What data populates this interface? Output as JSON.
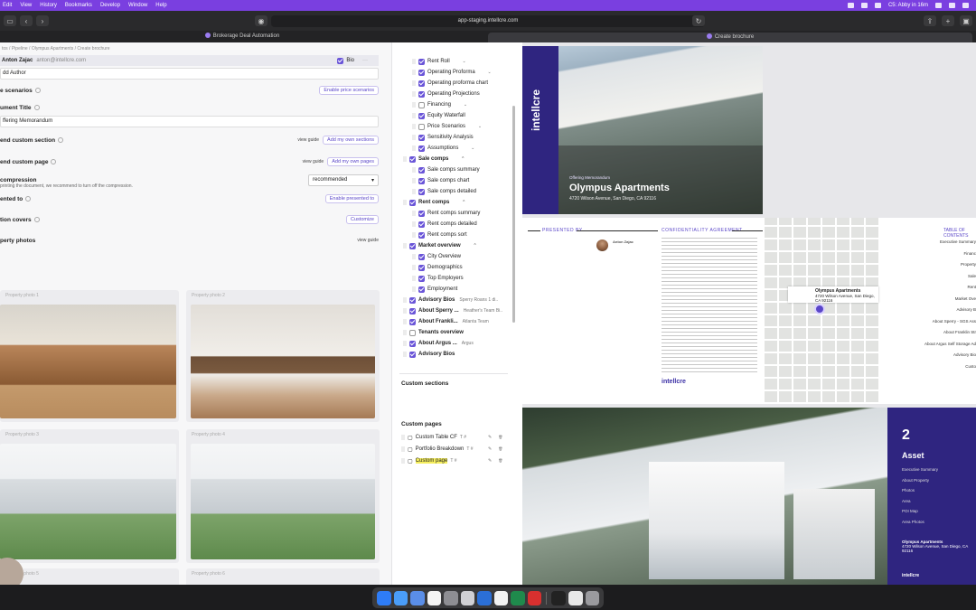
{
  "menubar": {
    "items": [
      "Edit",
      "View",
      "History",
      "Bookmarks",
      "Develop",
      "Window",
      "Help"
    ],
    "status_text": "C5: Abby in 16m"
  },
  "browser": {
    "url": "app-staging.intellcre.com",
    "tabs": [
      {
        "label": "Brokerage Deal Automation"
      },
      {
        "label": "Create brochure"
      }
    ]
  },
  "editor": {
    "breadcrumb": [
      "tos",
      "Pipeline",
      "Olympus Apartments",
      "Create brochure"
    ],
    "author": {
      "name": "Anton Zajac",
      "email": "anton@intellcre.com",
      "bio_label": "Bio"
    },
    "add_author_label": "dd Author",
    "price_scenarios": {
      "label": "e scenarios",
      "button": "Enable price scenarios"
    },
    "doc_title": {
      "label": "ument Title",
      "value": "ffering Memorandum"
    },
    "custom_section": {
      "label": "end custom section",
      "guide": "view guide",
      "button": "Add my own sections"
    },
    "custom_page": {
      "label": "end custom page",
      "guide": "view guide",
      "button": "Add my own pages"
    },
    "compression": {
      "label": "compression",
      "note": "printing the document, we recommend to turn off the compression.",
      "value": "recommended"
    },
    "presented_to": {
      "label": "ented to",
      "button": "Enable presented to"
    },
    "covers": {
      "label": "tion covers",
      "button": "Customize"
    },
    "photos": {
      "label": "perty photos",
      "guide": "view guide",
      "items": [
        {
          "label": "Property photo 1"
        },
        {
          "label": "Property photo 2"
        },
        {
          "label": "Property photo 3"
        },
        {
          "label": "Property photo 4"
        },
        {
          "label": "Property photo 5"
        },
        {
          "label": "Property photo 6"
        }
      ]
    }
  },
  "outline": {
    "items": [
      {
        "label": "Rent Roll",
        "checked": true
      },
      {
        "label": "Operating Proforma",
        "checked": true
      },
      {
        "label": "Operating proforma chart",
        "checked": true
      },
      {
        "label": "Operating Projections",
        "checked": true
      },
      {
        "label": "Financing",
        "checked": false
      },
      {
        "label": "Equity Waterfall",
        "checked": true
      },
      {
        "label": "Price Scenarios",
        "checked": false
      },
      {
        "label": "Sensitivity Analysis",
        "checked": true
      },
      {
        "label": "Assumptions",
        "checked": true
      },
      {
        "label": "Sale comps",
        "checked": true
      },
      {
        "label": "Sale comps summary",
        "checked": true
      },
      {
        "label": "Sale comps chart",
        "checked": true
      },
      {
        "label": "Sale comps detailed",
        "checked": true
      },
      {
        "label": "Rent comps",
        "checked": true
      },
      {
        "label": "Rent comps summary",
        "checked": true
      },
      {
        "label": "Rent comps detailed",
        "checked": true
      },
      {
        "label": "Rent comps sort",
        "checked": true
      },
      {
        "label": "Market overview",
        "checked": true
      },
      {
        "label": "City Overview",
        "checked": true
      },
      {
        "label": "Demographics",
        "checked": true
      },
      {
        "label": "Top Employers",
        "checked": true
      },
      {
        "label": "Employment",
        "checked": true
      },
      {
        "label": "Advisory Bios",
        "meta": "Sperry Roans 1 di..",
        "checked": true
      },
      {
        "label": "About Sperry ...",
        "meta": "Heather's Team Bi..",
        "checked": true
      },
      {
        "label": "About Frankli...",
        "meta": "Atlanta Team",
        "checked": true
      },
      {
        "label": "Tenants overview",
        "checked": false
      },
      {
        "label": "About Argus ...",
        "meta": "Argus",
        "checked": true
      },
      {
        "label": "Advisory Bios",
        "checked": true
      }
    ],
    "custom_sections_label": "Custom sections",
    "custom_pages_label": "Custom pages",
    "custom_pages": [
      {
        "label": "Custom Table CF"
      },
      {
        "label": "Portfolio Breakdown"
      },
      {
        "label": "Custom page"
      }
    ]
  },
  "preview": {
    "brand": "intellcre",
    "cover": {
      "eyebrow": "Offering Memorandum",
      "title": "Olympus Apartments",
      "address": "4720 Wilson Avenue, San Diego, CA 92116"
    },
    "presented_by": "PRESENTED BY",
    "agent_name": "Anton Zajac",
    "confidentiality": "CONFIDENTIALITY AGREEMENT",
    "map_card": {
      "title": "Olympus Apartments",
      "address": "4720 Wilson Avenue, San Diego, CA 92116"
    },
    "toc_title": "TABLE OF CONTENTS",
    "toc": [
      "Executive Summary",
      "Financ",
      "Property",
      "Sale",
      "Rent",
      "Market Ove",
      "Advisory B",
      "About Sperry - SGS Ass",
      "About Franklin Str",
      "About Argus Self Storage Ad",
      "Advisory Bio",
      "Custo"
    ],
    "asset_section": {
      "number": "2",
      "title": "Asset",
      "items": [
        "Executive Summary",
        "About Property",
        "Photos",
        "Area",
        "POI Map",
        "Area Photos"
      ],
      "footer_name": "Olympus Apartments",
      "footer_address": "4720 Wilson Avenue, San Diego, CA 92116"
    }
  }
}
